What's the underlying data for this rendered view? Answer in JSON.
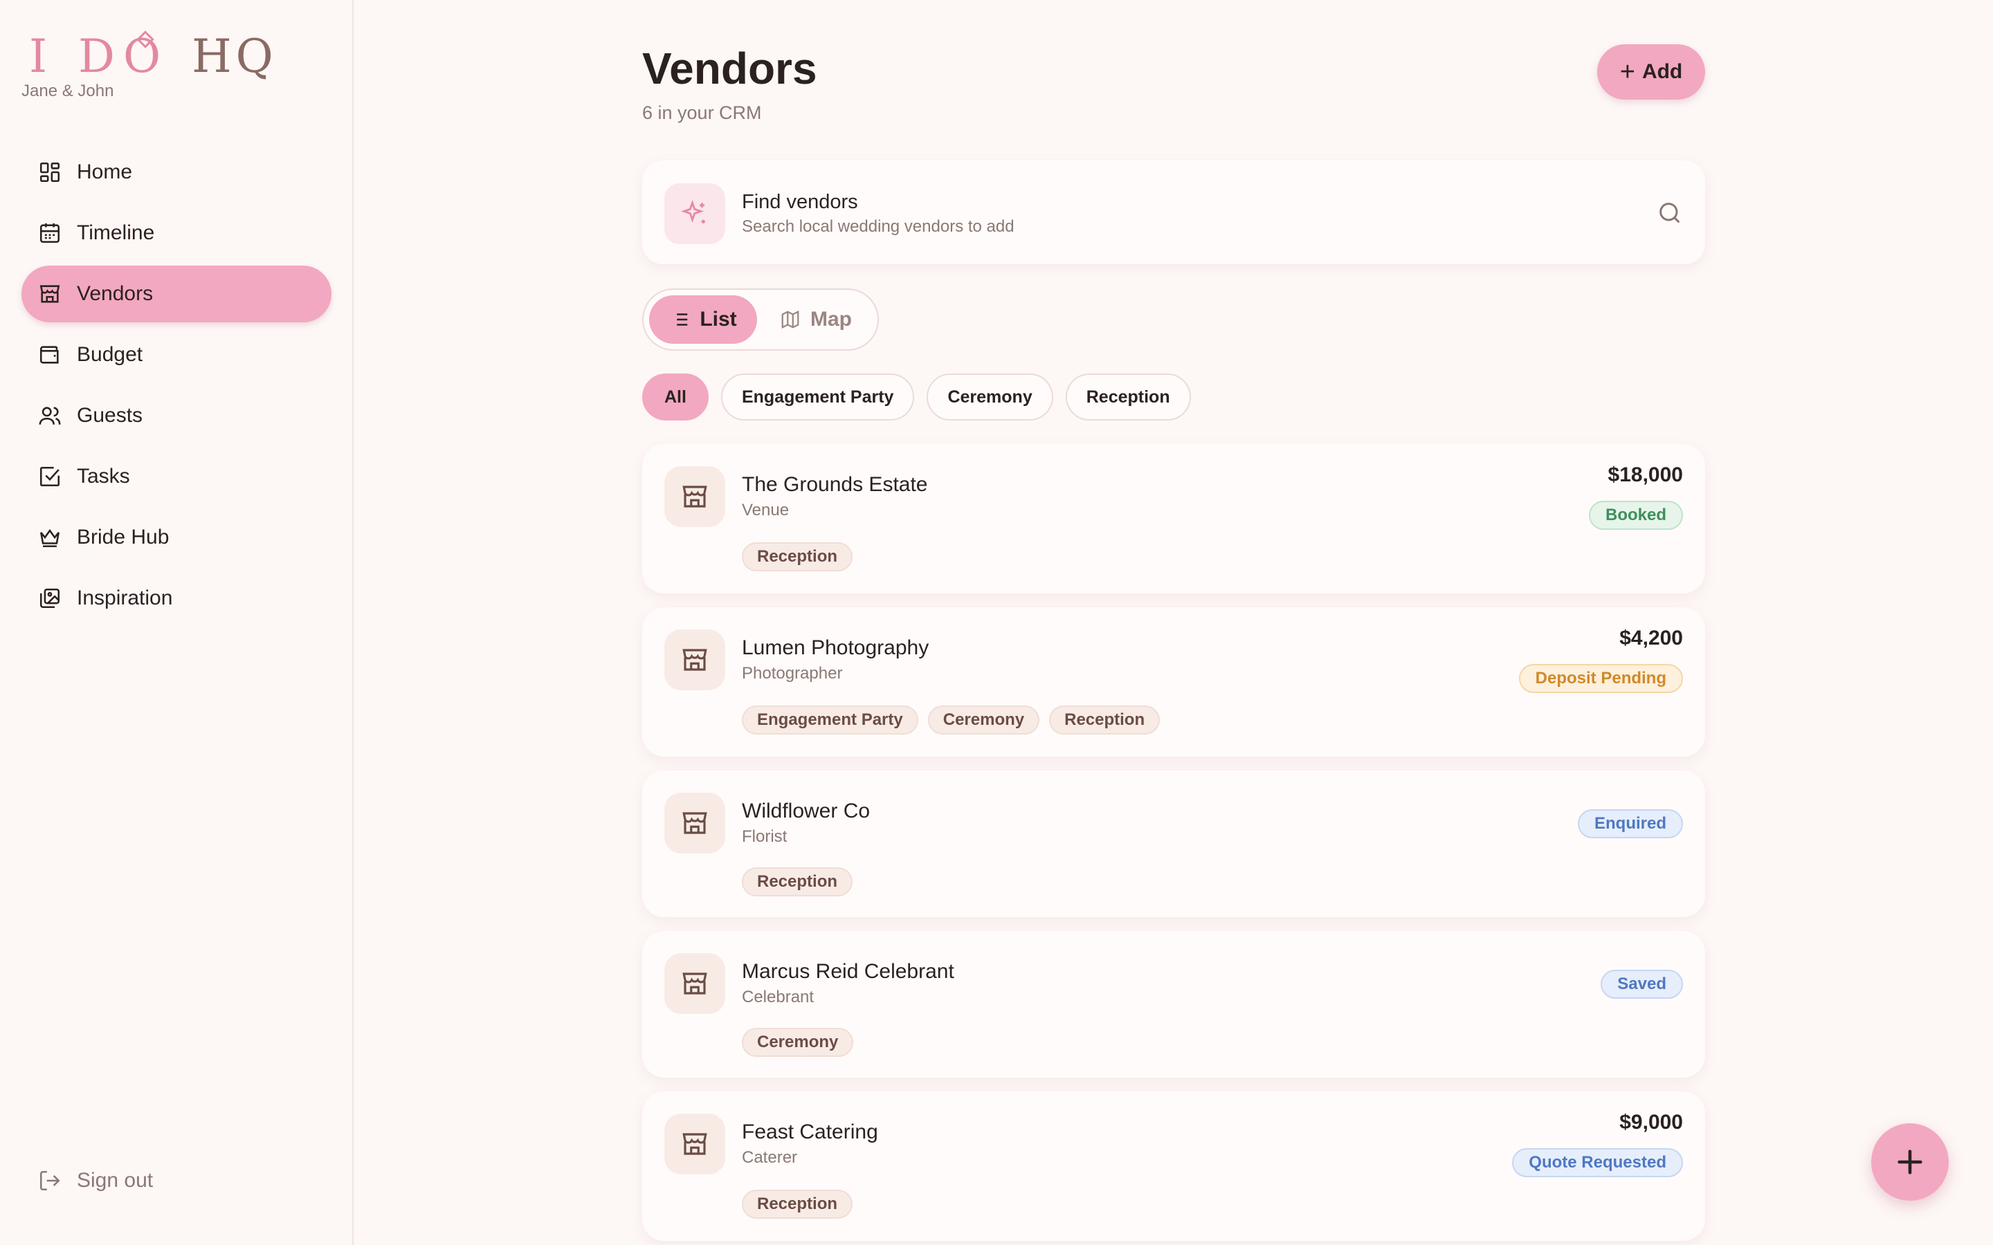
{
  "app": {
    "logo_main": "I DO",
    "logo_hq": "HQ",
    "couple": "Jane & John"
  },
  "sidebar": {
    "items": [
      {
        "label": "Home",
        "icon": "grid-icon"
      },
      {
        "label": "Timeline",
        "icon": "calendar-icon"
      },
      {
        "label": "Vendors",
        "icon": "store-icon",
        "active": true
      },
      {
        "label": "Budget",
        "icon": "wallet-icon"
      },
      {
        "label": "Guests",
        "icon": "users-icon"
      },
      {
        "label": "Tasks",
        "icon": "check-square-icon"
      },
      {
        "label": "Bride Hub",
        "icon": "crown-icon"
      },
      {
        "label": "Inspiration",
        "icon": "images-icon"
      }
    ],
    "signout": "Sign out"
  },
  "header": {
    "title": "Vendors",
    "subtitle": "6 in your CRM",
    "add_label": "Add"
  },
  "find": {
    "title": "Find vendors",
    "subtitle": "Search local wedding vendors to add"
  },
  "view_toggle": {
    "list": "List",
    "map": "Map",
    "selected": "List"
  },
  "filters": {
    "items": [
      "All",
      "Engagement Party",
      "Ceremony",
      "Reception"
    ],
    "selected": "All"
  },
  "vendors": [
    {
      "name": "The Grounds Estate",
      "category": "Venue",
      "price": "$18,000",
      "status": "Booked",
      "tags": [
        "Reception"
      ]
    },
    {
      "name": "Lumen Photography",
      "category": "Photographer",
      "price": "$4,200",
      "status": "Deposit Pending",
      "tags": [
        "Engagement Party",
        "Ceremony",
        "Reception"
      ]
    },
    {
      "name": "Wildflower Co",
      "category": "Florist",
      "price": "",
      "status": "Enquired",
      "tags": [
        "Reception"
      ]
    },
    {
      "name": "Marcus Reid Celebrant",
      "category": "Celebrant",
      "price": "",
      "status": "Saved",
      "tags": [
        "Ceremony"
      ]
    },
    {
      "name": "Feast Catering",
      "category": "Caterer",
      "price": "$9,000",
      "status": "Quote Requested",
      "tags": [
        "Reception"
      ]
    }
  ],
  "colors": {
    "accent": "#f2a8c0",
    "background": "#fdf7f6",
    "booked": "#3f8f5a",
    "deposit": "#d08a2a",
    "info": "#4f78c2"
  }
}
